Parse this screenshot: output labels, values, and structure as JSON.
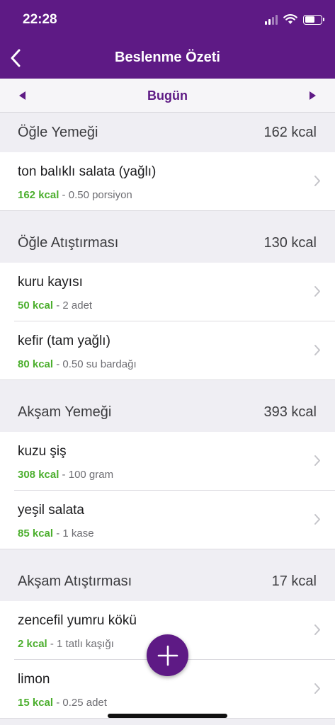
{
  "status": {
    "time": "22:28"
  },
  "nav": {
    "title": "Beslenme Özeti"
  },
  "date": {
    "label": "Bugün"
  },
  "sections": [
    {
      "title": "Öğle Yemeği",
      "total": "162 kcal",
      "items": [
        {
          "name": "ton balıklı salata (yağlı)",
          "kcal": "162 kcal",
          "detail": " - 0.50 porsiyon"
        }
      ]
    },
    {
      "title": "Öğle Atıştırması",
      "total": "130 kcal",
      "items": [
        {
          "name": "kuru kayısı",
          "kcal": "50 kcal",
          "detail": " - 2 adet"
        },
        {
          "name": "kefir (tam yağlı)",
          "kcal": "80 kcal",
          "detail": " - 0.50 su bardağı"
        }
      ]
    },
    {
      "title": "Akşam Yemeği",
      "total": "393 kcal",
      "items": [
        {
          "name": "kuzu şiş",
          "kcal": "308 kcal",
          "detail": " - 100 gram"
        },
        {
          "name": "yeşil salata",
          "kcal": "85 kcal",
          "detail": " - 1 kase"
        }
      ]
    },
    {
      "title": "Akşam Atıştırması",
      "total": "17 kcal",
      "items": [
        {
          "name": "zencefil yumru kökü",
          "kcal": "2 kcal",
          "detail": " - 1 tatlı kaşığı"
        },
        {
          "name": "limon",
          "kcal": "15 kcal",
          "detail": " - 0.25 adet"
        }
      ]
    }
  ],
  "colors": {
    "brand": "#5e1a85",
    "kcal": "#4caf2e"
  },
  "icons": {
    "back": "chevron-left-icon",
    "prev": "triangle-left-icon",
    "next": "triangle-right-icon",
    "add": "plus-icon",
    "row": "chevron-right-icon"
  }
}
